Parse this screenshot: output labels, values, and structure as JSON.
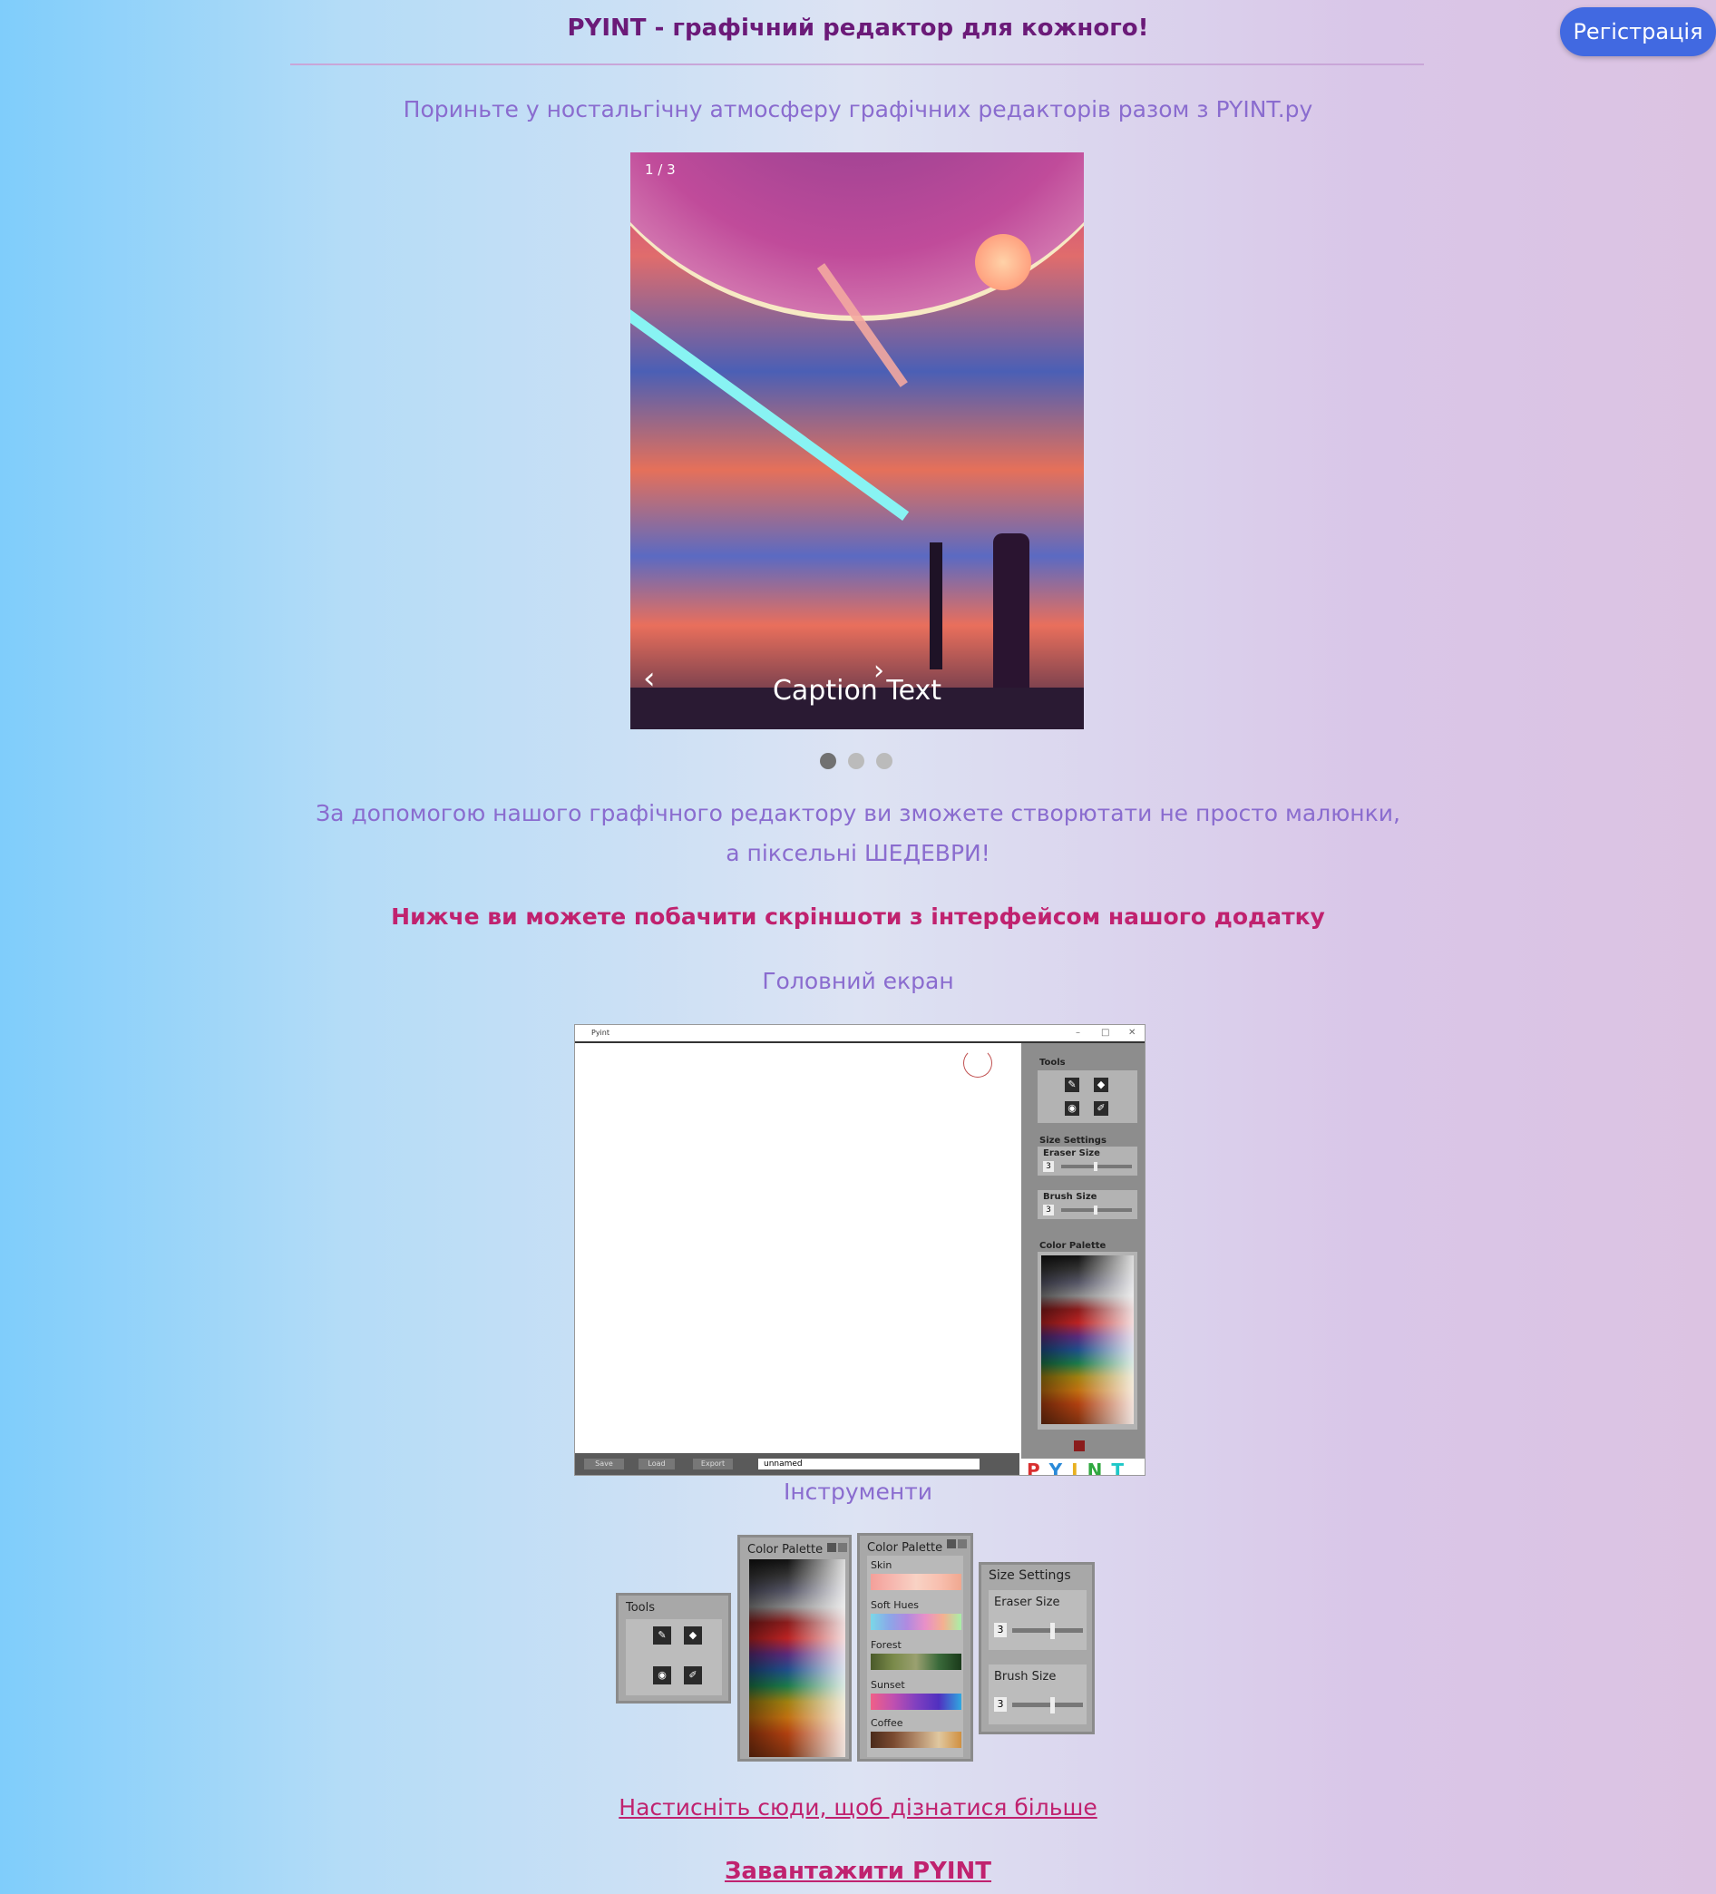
{
  "header": {
    "title": "PYINT - графічний редактор для кожного!",
    "register_label": "Регістрація"
  },
  "intro": "Пориньте у ностальгічну атмосферу графічних редакторів разом з PYINT.py",
  "slideshow": {
    "counter": "1 / 3",
    "prev_icon": "‹",
    "next_icon": "›",
    "caption": "Caption Text",
    "dots": 3,
    "active_dot": 1
  },
  "description": {
    "line1": "За допомогою нашого графічного редактору ви зможете створютати не просто малюнки,",
    "line2": "а піксельні ШЕДЕВРИ!"
  },
  "screenshots_heading": "Нижче ви можете побачити скріншоти з інтерфейсом нашого додатку",
  "main_screen_label": "Головний екран",
  "app": {
    "window_title": "Pyint",
    "window_controls": [
      "–",
      "□",
      "✕"
    ],
    "tools_label": "Tools",
    "size_settings_label": "Size Settings",
    "eraser_label": "Eraser Size",
    "eraser_value": "3",
    "brush_label": "Brush Size",
    "brush_value": "3",
    "palette_label": "Color Palette",
    "save_label": "Save",
    "load_label": "Load",
    "export_label": "Export",
    "file_name": "unnamed",
    "logo": "PYINT"
  },
  "tools_section_label": "Інструменти",
  "tool_cards": {
    "tools_title": "Tools",
    "palette_title": "Color Palette",
    "palette2_groups": [
      "Skin",
      "Soft Hues",
      "Forest",
      "Sunset",
      "Coffee"
    ],
    "size_title": "Size Settings",
    "eraser_label": "Eraser Size",
    "eraser_value": "3",
    "brush_label": "Brush Size",
    "brush_value": "3"
  },
  "links": {
    "learn_more": "Настисніть сюди, щоб дізнатися більше",
    "download": "Завантажити PYINT"
  },
  "colors": {
    "accent": "#4169e1",
    "title": "#6b1a78",
    "link": "#c0226f",
    "text": "#8a6ccf"
  }
}
